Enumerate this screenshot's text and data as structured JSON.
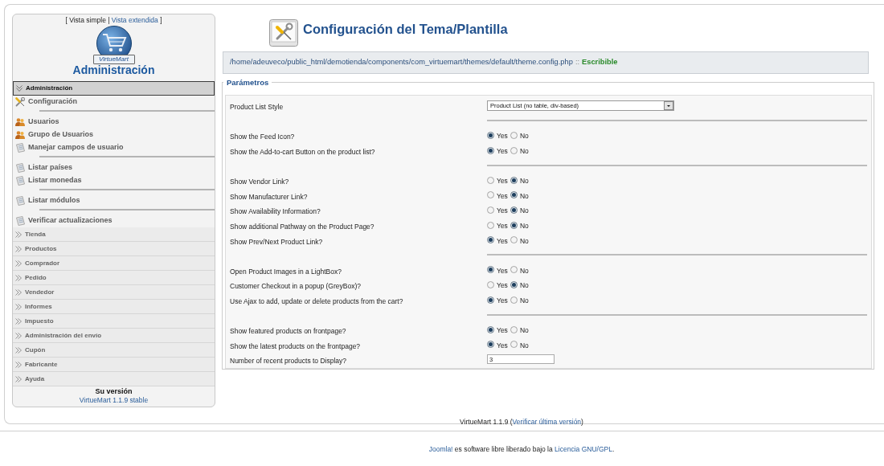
{
  "view_switch": {
    "open": "[",
    "links": [
      {
        "label": "Vista simple",
        "selected": true
      },
      {
        "label": "Vista extendida",
        "selected": false
      }
    ],
    "separator": "|",
    "close": "]"
  },
  "logo": {
    "label": "VirtueMart"
  },
  "sidebar": {
    "heading": "Administración",
    "sections": [
      {
        "label": "Administración",
        "expanded": true,
        "groups": [
          [
            {
              "label": "Configuración",
              "kind": "tools"
            }
          ],
          [
            {
              "label": "Usuarios",
              "kind": "users"
            },
            {
              "label": "Grupo de Usuarios",
              "kind": "users"
            },
            {
              "label": "Manejar campos de usuario",
              "kind": "document"
            }
          ],
          [
            {
              "label": "Listar países",
              "kind": "document"
            },
            {
              "label": "Listar monedas",
              "kind": "document"
            }
          ],
          [
            {
              "label": "Listar módulos",
              "kind": "document"
            }
          ],
          [
            {
              "label": "Verificar actualizaciones",
              "kind": "document"
            }
          ]
        ]
      },
      {
        "label": "Tienda",
        "expanded": false
      },
      {
        "label": "Productos",
        "expanded": false
      },
      {
        "label": "Comprador",
        "expanded": false
      },
      {
        "label": "Pedido",
        "expanded": false
      },
      {
        "label": "Vendedor",
        "expanded": false
      },
      {
        "label": "Informes",
        "expanded": false
      },
      {
        "label": "Impuesto",
        "expanded": false
      },
      {
        "label": "Administración del envío",
        "expanded": false
      },
      {
        "label": "Cupón",
        "expanded": false
      },
      {
        "label": "Fabricante",
        "expanded": false
      },
      {
        "label": "Ayuda",
        "expanded": false
      }
    ],
    "version": {
      "label": "Su versión",
      "link": "VirtueMart 1.1.9 stable"
    }
  },
  "page": {
    "title": "Configuración del Tema/Plantilla",
    "file": {
      "path": "/home/adeuveco/public_html/demotienda/components/com_virtuemart/themes/default/theme.config.php",
      "separator": "::",
      "status": "Escribible",
      "writable": true
    }
  },
  "form": {
    "legend": "Parámetros",
    "rows": [
      {
        "kind": "select",
        "label": "Product List Style",
        "value": "Product List (no table, div-based)"
      },
      {
        "kind": "separator"
      },
      {
        "kind": "radio",
        "label": "Show the Feed Icon?",
        "options": [
          {
            "label": "Yes",
            "selected": true
          },
          {
            "label": "No",
            "selected": false
          }
        ]
      },
      {
        "kind": "radio",
        "label": "Show the Add-to-cart Button on the product list?",
        "options": [
          {
            "label": "Yes",
            "selected": true
          },
          {
            "label": "No",
            "selected": false
          }
        ]
      },
      {
        "kind": "separator"
      },
      {
        "kind": "radio",
        "label": "Show Vendor Link?",
        "options": [
          {
            "label": "Yes",
            "selected": false
          },
          {
            "label": "No",
            "selected": true
          }
        ]
      },
      {
        "kind": "radio",
        "label": "Show Manufacturer Link?",
        "options": [
          {
            "label": "Yes",
            "selected": false
          },
          {
            "label": "No",
            "selected": true
          }
        ]
      },
      {
        "kind": "radio",
        "label": "Show Availability Information?",
        "options": [
          {
            "label": "Yes",
            "selected": false
          },
          {
            "label": "No",
            "selected": true
          }
        ]
      },
      {
        "kind": "radio",
        "label": "Show additional Pathway on the Product Page?",
        "options": [
          {
            "label": "Yes",
            "selected": false
          },
          {
            "label": "No",
            "selected": true
          }
        ]
      },
      {
        "kind": "radio",
        "label": "Show Prev/Next Product Link?",
        "options": [
          {
            "label": "Yes",
            "selected": true
          },
          {
            "label": "No",
            "selected": false
          }
        ]
      },
      {
        "kind": "separator"
      },
      {
        "kind": "radio",
        "label": "Open Product Images in a LightBox?",
        "options": [
          {
            "label": "Yes",
            "selected": true
          },
          {
            "label": "No",
            "selected": false
          }
        ]
      },
      {
        "kind": "radio",
        "label": "Customer Checkout in a popup (GreyBox)?",
        "options": [
          {
            "label": "Yes",
            "selected": false
          },
          {
            "label": "No",
            "selected": true
          }
        ]
      },
      {
        "kind": "radio",
        "label": "Use Ajax to add, update or delete products from the cart?",
        "options": [
          {
            "label": "Yes",
            "selected": true
          },
          {
            "label": "No",
            "selected": false
          }
        ]
      },
      {
        "kind": "separator"
      },
      {
        "kind": "radio",
        "label": "Show featured products on frontpage?",
        "options": [
          {
            "label": "Yes",
            "selected": true
          },
          {
            "label": "No",
            "selected": false
          }
        ]
      },
      {
        "kind": "radio",
        "label": "Show the latest products on the frontpage?",
        "options": [
          {
            "label": "Yes",
            "selected": true
          },
          {
            "label": "No",
            "selected": false
          }
        ]
      },
      {
        "kind": "text",
        "label": "Number of recent products to Display?",
        "value": "3"
      }
    ]
  },
  "footer": {
    "version_line": {
      "before": "VirtueMart 1.1.9 (",
      "link": "Verificar última versión",
      "after": ")"
    },
    "license": {
      "brand_link": "Joomla!",
      "text": " es software libre liberado bajo la ",
      "license_link": "Licencia GNU/GPL",
      "after": "."
    }
  }
}
